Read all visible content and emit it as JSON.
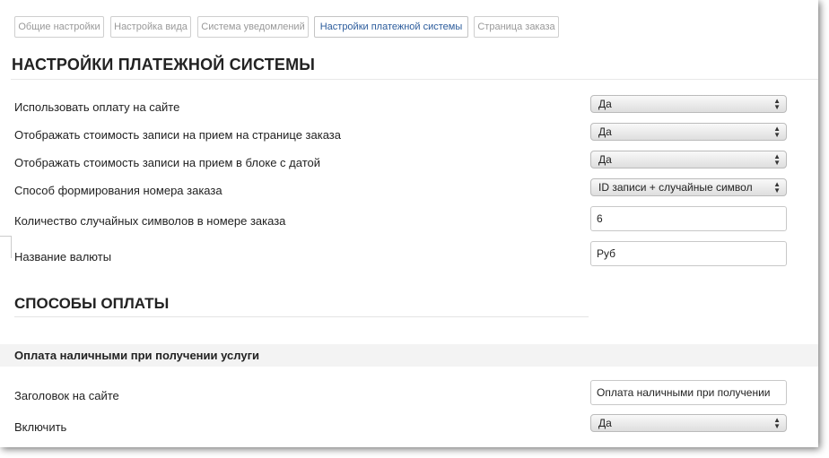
{
  "tabs": [
    {
      "label": "Общие настройки"
    },
    {
      "label": "Настройка вида"
    },
    {
      "label": "Система уведомлений"
    },
    {
      "label": "Настройки платежной системы",
      "active": true
    },
    {
      "label": "Страница заказа"
    }
  ],
  "section_title": "НАСТРОЙКИ ПЛАТЕЖНОЙ СИСТЕМЫ",
  "settings": {
    "use_payment": {
      "label": "Использовать оплату на сайте",
      "value": "Да"
    },
    "show_price_order_page": {
      "label": "Отображать стоимость записи на прием на странице заказа",
      "value": "Да"
    },
    "show_price_date_block": {
      "label": "Отображать стоимость записи на прием в блоке с датой",
      "value": "Да"
    },
    "order_number_method": {
      "label": "Способ формирования номера заказа",
      "value": "ID записи + случайные символ"
    },
    "random_chars_count": {
      "label": "Количество случайных символов в номере заказа",
      "value": "6"
    },
    "currency_name": {
      "label": "Название валюты",
      "value": "Руб"
    }
  },
  "payment_methods_title": "СПОСОБЫ ОПЛАТЫ",
  "cash_payment": {
    "title": "Оплата наличными при получении услуги",
    "site_heading": {
      "label": "Заголовок на сайте",
      "value": "Оплата наличными при получении"
    },
    "enable": {
      "label": "Включить",
      "value": "Да"
    }
  }
}
